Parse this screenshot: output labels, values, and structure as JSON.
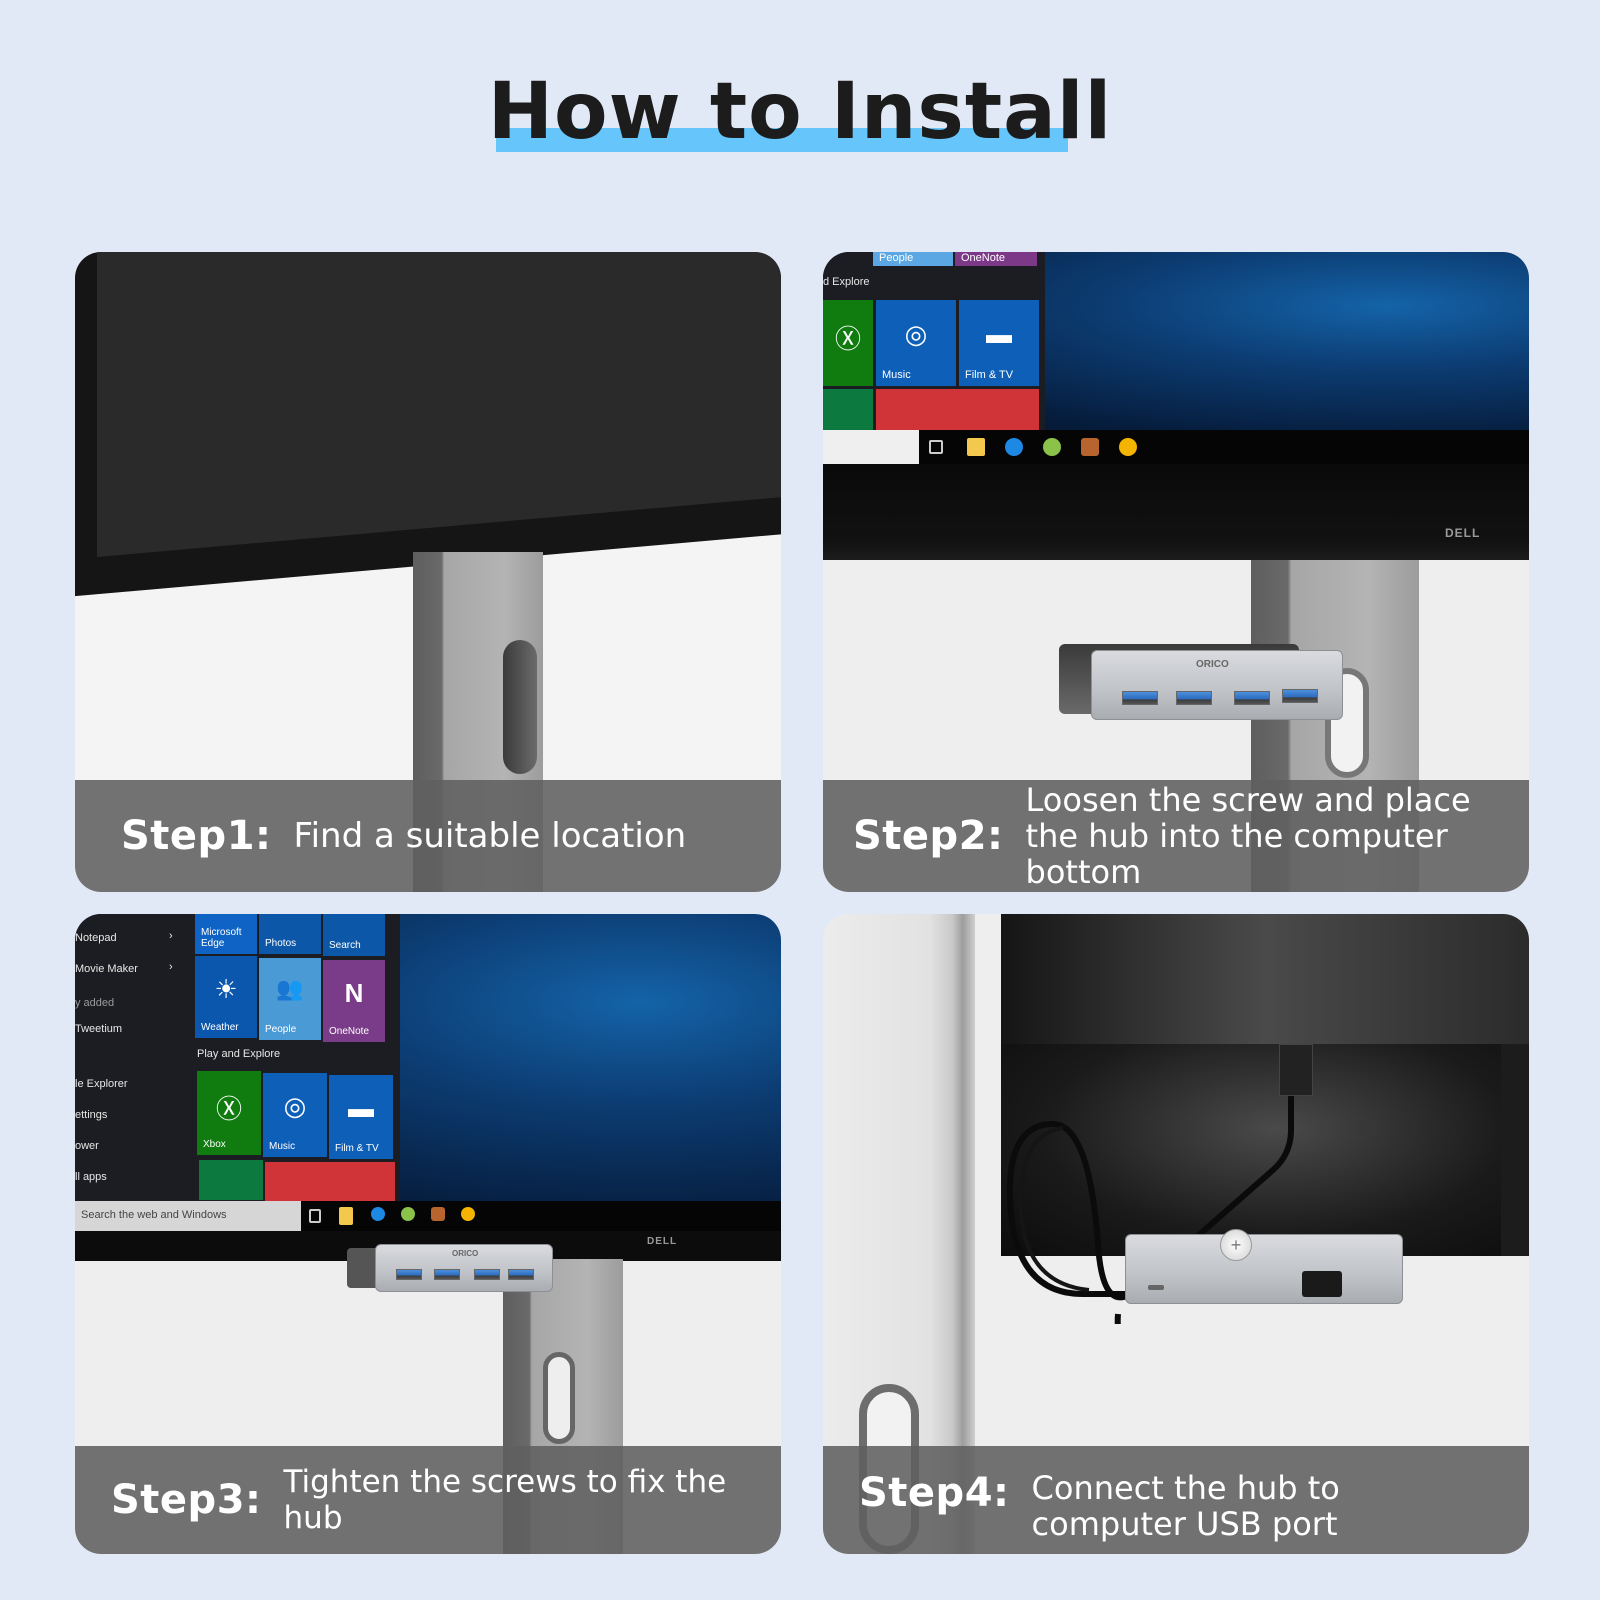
{
  "header": {
    "title": "How to Install",
    "underline_color": "#66c6fc"
  },
  "steps": [
    {
      "label": "Step1:",
      "text": "Find a suitable location"
    },
    {
      "label": "Step2:",
      "text": "Loosen the screw and place the hub into the computer bottom",
      "screen": {
        "tile_labels": [
          "People",
          "OneNote",
          "Music",
          "Film & TV"
        ],
        "section_label": "d Explore",
        "brand": "DELL",
        "hub_brand": "ORICO"
      }
    },
    {
      "label": "Step3:",
      "text": "Tighten the screws to fix the hub",
      "screen": {
        "menu_items": [
          "Notepad",
          "Movie Maker",
          "y added",
          "Tweetium",
          "le Explorer",
          "ettings",
          "ower",
          "ll apps"
        ],
        "tiles_top": [
          "Microsoft Edge",
          "Photos",
          "Search"
        ],
        "tiles_mid": [
          "Weather",
          "People",
          "OneNote"
        ],
        "section_label": "Play and Explore",
        "tiles_play": [
          "Xbox",
          "Music",
          "Film & TV"
        ],
        "search_placeholder": "Search the web and Windows",
        "brand": "DELL",
        "hub_brand": "ORICO"
      }
    },
    {
      "label": "Step4:",
      "text": "Connect the hub to computer USB port"
    }
  ],
  "icons": {
    "chevron": "›",
    "xbox": "Ⓧ",
    "music": "◎",
    "film": "▬",
    "weather": "☀",
    "people": "👥",
    "onenote": "N",
    "screw": "+"
  }
}
